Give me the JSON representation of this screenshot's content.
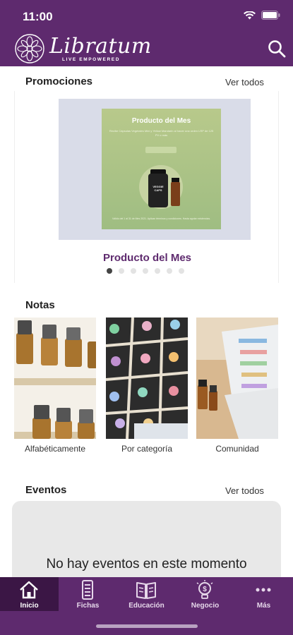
{
  "status_bar": {
    "time": "11:00"
  },
  "header": {
    "logo_text": "Libratum",
    "tagline": "LIVE EMPOWERED"
  },
  "promotions": {
    "title": "Promociones",
    "see_all": "Ver todos",
    "banner": {
      "heading": "Producto del Mes",
      "body": "Recibe Cápsulas Vegetales Mini y Yellow Mandarin al hacer una orden LRP de 125 PV o más",
      "footer": "Válido del 1 al 31 de Mes 2021. Aplican términos y condiciones. Hasta agotar existencias.",
      "bottle_label": "VEGGIE CAPS"
    },
    "caption": "Producto del Mes",
    "dots_count": 7,
    "active_dot": 0
  },
  "notes": {
    "title": "Notas",
    "items": [
      {
        "label": "Alfabéticamente"
      },
      {
        "label": "Por categoría"
      },
      {
        "label": "Comunidad"
      }
    ]
  },
  "events": {
    "title": "Eventos",
    "see_all": "Ver todos",
    "empty_message": "No hay eventos en este momento"
  },
  "tab_bar": {
    "tabs": [
      {
        "label": "Inicio",
        "icon": "home-icon"
      },
      {
        "label": "Fichas",
        "icon": "cards-icon"
      },
      {
        "label": "Educación",
        "icon": "book-icon"
      },
      {
        "label": "Negocio",
        "icon": "lightbulb-dollar-icon"
      },
      {
        "label": "Más",
        "icon": "more-icon"
      }
    ],
    "active_index": 0
  },
  "colors": {
    "brand": "#5e2a6e",
    "brand_dark": "#3b1645",
    "caption": "#5e2a6e"
  }
}
